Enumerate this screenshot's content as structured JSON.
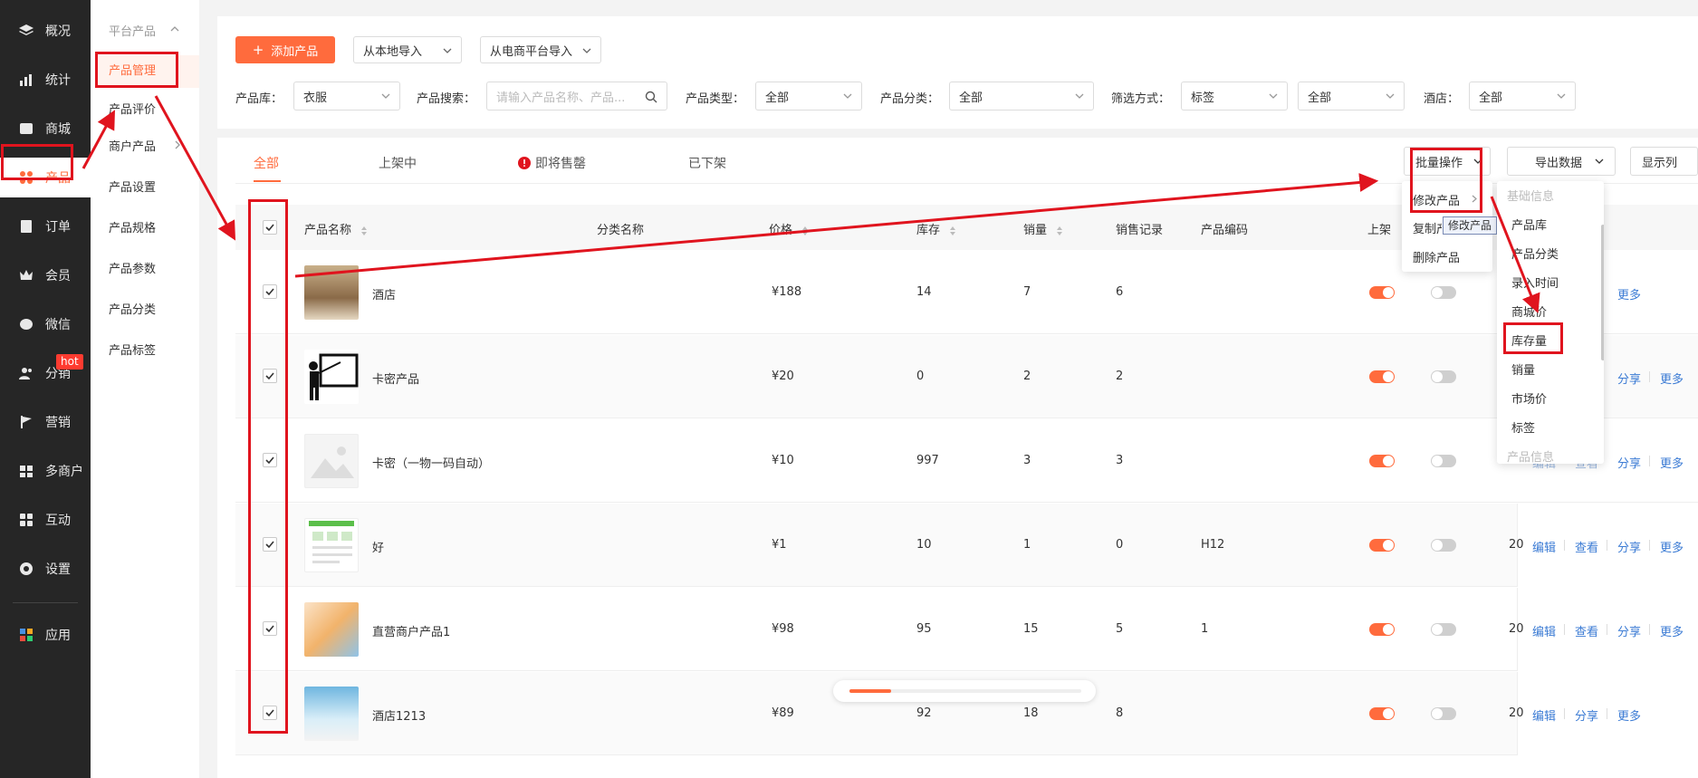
{
  "sidebar": {
    "items": [
      {
        "label": "概况",
        "icon": "layers-icon"
      },
      {
        "label": "统计",
        "icon": "chart-icon"
      },
      {
        "label": "商城",
        "icon": "shop-icon"
      },
      {
        "label": "产品",
        "icon": "grid-icon",
        "active": true
      },
      {
        "label": "订单",
        "icon": "order-icon"
      },
      {
        "label": "会员",
        "icon": "crown-icon"
      },
      {
        "label": "微信",
        "icon": "wechat-icon"
      },
      {
        "label": "分销",
        "icon": "users-icon"
      },
      {
        "label": "营销",
        "icon": "flag-icon"
      },
      {
        "label": "多商户",
        "icon": "store-icon"
      },
      {
        "label": "互动",
        "icon": "apps-icon"
      },
      {
        "label": "设置",
        "icon": "gear-icon"
      },
      {
        "label": "应用",
        "icon": "app-color-icon"
      }
    ],
    "hot_badge": "hot"
  },
  "submenu": {
    "group": "平台产品",
    "items": [
      "产品管理",
      "产品评价",
      "商户产品",
      "产品设置",
      "产品规格",
      "产品参数",
      "产品分类",
      "产品标签"
    ]
  },
  "toolbar": {
    "add": "添加产品",
    "import_local": "从本地导入",
    "import_ecom": "从电商平台导入"
  },
  "filters": {
    "library_label": "产品库：",
    "library_value": "衣服",
    "search_label": "产品搜索：",
    "search_placeholder": "请输入产品名称、产品...",
    "type_label": "产品类型：",
    "type_value": "全部",
    "category_label": "产品分类：",
    "category_value": "全部",
    "method_label": "筛选方式：",
    "method_value": "标签",
    "method_value2": "全部",
    "hotel_label": "酒店：",
    "hotel_value": "全部"
  },
  "tabs": [
    "全部",
    "上架中",
    "即将售罄",
    "已下架"
  ],
  "actions_bar": {
    "batch": "批量操作",
    "export": "导出数据",
    "columns": "显示列"
  },
  "table": {
    "headers": [
      "产品名称",
      "分类名称",
      "价格",
      "库存",
      "销量",
      "销售记录",
      "产品编码",
      "上架"
    ],
    "rows": [
      {
        "name": "酒店",
        "price": "¥188",
        "stock": "14",
        "sales": "7",
        "records": "6",
        "code": "",
        "links": [
          "编辑",
          "查看",
          "分享",
          "更多"
        ]
      },
      {
        "name": "卡密产品",
        "price": "¥20",
        "stock": "0",
        "sales": "2",
        "records": "2",
        "code": "",
        "links": [
          "编辑",
          "查看",
          "分享",
          "更多"
        ]
      },
      {
        "name": "卡密（一物一码自动）",
        "price": "¥10",
        "stock": "997",
        "sales": "3",
        "records": "3",
        "code": "",
        "links": [
          "编辑",
          "查看",
          "分享",
          "更多"
        ]
      },
      {
        "name": "好",
        "price": "¥1",
        "stock": "10",
        "sales": "1",
        "records": "0",
        "code": "H12",
        "links": [
          "编辑",
          "查看",
          "分享",
          "更多"
        ]
      },
      {
        "name": "直营商户产品1",
        "price": "¥98",
        "stock": "95",
        "sales": "15",
        "records": "5",
        "code": "1",
        "links": [
          "编辑",
          "查看",
          "分享",
          "更多"
        ]
      },
      {
        "name": "酒店1213",
        "price": "¥89",
        "stock": "92",
        "sales": "18",
        "records": "8",
        "code": "",
        "links": [
          "编辑",
          "分享",
          "更多"
        ]
      }
    ],
    "truncated_col": "20"
  },
  "batch_menu": {
    "items": [
      "修改产品",
      "复制产品",
      "删除产品"
    ],
    "tooltip": "修改产品"
  },
  "field_menu": {
    "group1": "基础信息",
    "options": [
      "产品库",
      "产品分类",
      "录入时间",
      "商城价",
      "库存量",
      "销量",
      "市场价",
      "标签"
    ],
    "group2": "产品信息"
  },
  "progress": {
    "value": 0.18
  },
  "colors": {
    "accent": "#ff6b3d",
    "annotation": "#e0141e",
    "link": "#3b7bd4",
    "sidebar": "#262626"
  }
}
